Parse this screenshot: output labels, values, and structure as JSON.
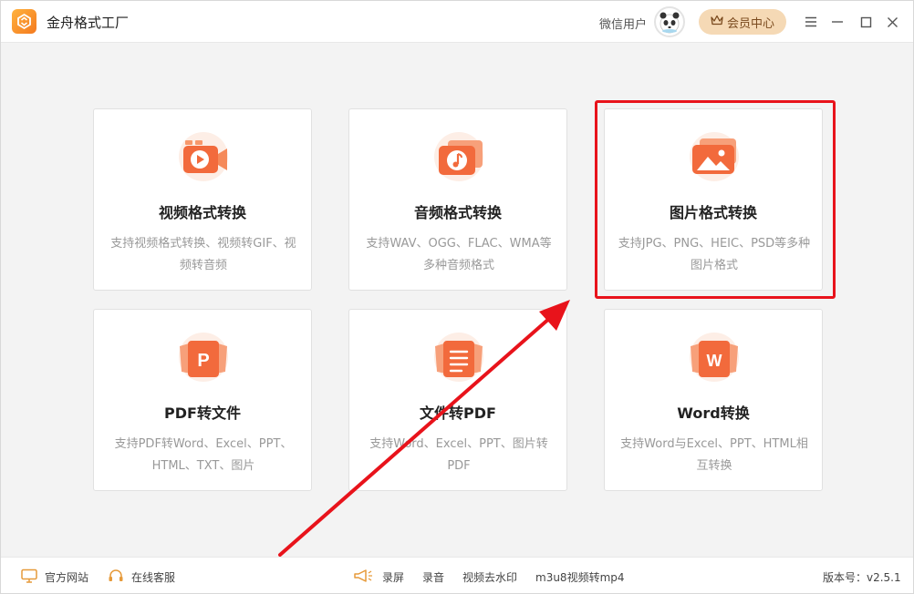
{
  "titlebar": {
    "app_title": "金舟格式工厂",
    "user_name": "微信用户",
    "vip_label": "会员中心"
  },
  "cards": [
    {
      "title": "视频格式转换",
      "desc": "支持视频格式转换、视频转GIF、视频转音频",
      "icon": "video-play-icon"
    },
    {
      "title": "音频格式转换",
      "desc": "支持WAV、OGG、FLAC、WMA等多种音频格式",
      "icon": "music-note-icon"
    },
    {
      "title": "图片格式转换",
      "desc": "支持JPG、PNG、HEIC、PSD等多种图片格式",
      "icon": "image-icon"
    },
    {
      "title": "PDF转文件",
      "desc": "支持PDF转Word、Excel、PPT、HTML、TXT、图片",
      "icon": "pdf-p-icon"
    },
    {
      "title": "文件转PDF",
      "desc": "支持Word、Excel、PPT、图片转PDF",
      "icon": "document-lines-icon"
    },
    {
      "title": "Word转换",
      "desc": "支持Word与Excel、PPT、HTML相互转换",
      "icon": "word-w-icon"
    }
  ],
  "footer": {
    "official_site": "官方网站",
    "online_support": "在线客服",
    "screen_record": "录屏",
    "audio_record": "录音",
    "remove_watermark": "视频去水印",
    "m3u8_convert": "m3u8视频转mp4",
    "version_label": "版本号：v2.5.1"
  },
  "colors": {
    "accent": "#f47a1f",
    "highlight_box": "#e8131b",
    "vip_bg": "#f5d9b5"
  }
}
